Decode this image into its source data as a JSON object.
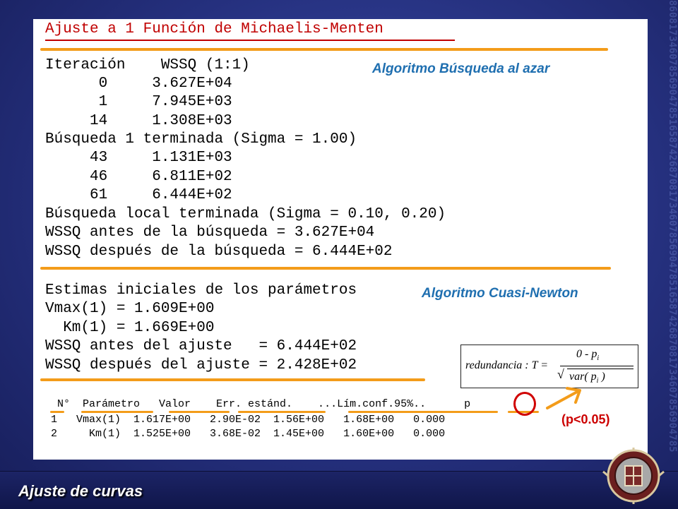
{
  "slide": {
    "background_digits": "860817346078569047851658742687081734607856904785165874268708173460785690478516587426870817346",
    "footer_title": "Ajuste de curvas"
  },
  "panel": {
    "title": "Ajuste a 1 Función de Michaelis-Menten",
    "search_block": {
      "header": "Iteración    WSSQ (1:1)",
      "rows": [
        "      0     3.627E+04",
        "      1     7.945E+03",
        "     14     1.308E+03"
      ],
      "status_1": "Búsqueda 1 terminada (Sigma = 1.00)",
      "rows2": [
        "     43     1.131E+03",
        "     46     6.811E+02",
        "     61     6.444E+02"
      ],
      "status_2": "Búsqueda local terminada (Sigma = 0.10, 0.20)",
      "wssq_before": "WSSQ antes de la búsqueda = 3.627E+04",
      "wssq_after": "WSSQ después de la búsqueda = 6.444E+02"
    },
    "fit_block": {
      "header": "Estimas iniciales de los parámetros",
      "vmax": "Vmax(1) = 1.609E+00",
      "km": "  Km(1) = 1.669E+00",
      "wssq_before": "WSSQ antes del ajuste   = 6.444E+02",
      "wssq_after": "WSSQ después del ajuste = 2.428E+02"
    },
    "labels": {
      "random_search": "Algoritmo Búsqueda al azar",
      "quasi_newton": "Algoritmo Cuasi-Newton"
    },
    "formula": {
      "lhs": "redundancia : T =",
      "numerator": "0 - p",
      "sub": "i",
      "den_a": "var( p",
      "den_b": " )"
    },
    "results_table": {
      "header": " N°  Parámetro   Valor    Err. estánd.    ...Lím.conf.95%..      p",
      "rows": [
        "1   Vmax(1)  1.617E+00   2.90E-02  1.56E+00   1.68E+00   0.000",
        "2     Km(1)  1.525E+00   3.68E-02  1.45E+00   1.60E+00   0.000"
      ]
    },
    "p_note": "(p<0.05)"
  },
  "colors": {
    "accent_orange": "#f39c1a",
    "title_red": "#c00000",
    "algo_blue": "#1f6fb0",
    "note_red": "#cc0000"
  }
}
